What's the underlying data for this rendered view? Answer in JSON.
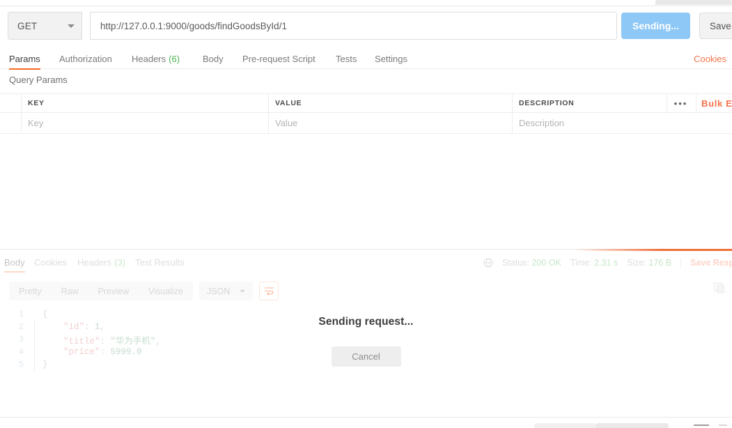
{
  "request": {
    "method": "GET",
    "url": "http://127.0.0.1:9000/goods/findGoodsById/1",
    "send_label": "Sending...",
    "save_label": "Save",
    "cookies_label": "Cookies",
    "tabs": [
      {
        "label": "Params",
        "count": "",
        "active": true
      },
      {
        "label": "Authorization",
        "count": "",
        "active": false
      },
      {
        "label": "Headers",
        "count": "(6)",
        "active": false
      },
      {
        "label": "Body",
        "count": "",
        "active": false
      },
      {
        "label": "Pre-request Script",
        "count": "",
        "active": false
      },
      {
        "label": "Tests",
        "count": "",
        "active": false
      },
      {
        "label": "Settings",
        "count": "",
        "active": false
      }
    ]
  },
  "query_params": {
    "section_title": "Query Params",
    "columns": [
      "KEY",
      "VALUE",
      "DESCRIPTION"
    ],
    "placeholders": {
      "key": "Key",
      "value": "Value",
      "description": "Description"
    },
    "dots_label": "•••",
    "bulk_label": "Bulk Edit"
  },
  "response": {
    "tabs": [
      {
        "label": "Body",
        "count": "",
        "active": true
      },
      {
        "label": "Cookies",
        "count": "",
        "active": false
      },
      {
        "label": "Headers",
        "count": "(3)",
        "active": false
      },
      {
        "label": "Test Results",
        "count": "",
        "active": false
      }
    ],
    "meta": {
      "status_label": "Status:",
      "status_value": "200 OK",
      "time_label": "Time:",
      "time_value": "2.31 s",
      "size_label": "Size:",
      "size_value": "176 B",
      "save_response_label": "Save Response"
    },
    "format_tabs": [
      "Pretty",
      "Raw",
      "Preview",
      "Visualize"
    ],
    "language": "JSON",
    "body_lines": [
      {
        "n": "1",
        "tokens": [
          {
            "t": "{",
            "c": "tk-punct"
          }
        ]
      },
      {
        "n": "2",
        "tokens": [
          {
            "t": "    \"id\"",
            "c": "tk-key"
          },
          {
            "t": ": ",
            "c": "tk-punct"
          },
          {
            "t": "1",
            "c": "tk-num"
          },
          {
            "t": ",",
            "c": "tk-punct"
          }
        ]
      },
      {
        "n": "3",
        "tokens": [
          {
            "t": "    \"title\"",
            "c": "tk-key"
          },
          {
            "t": ": ",
            "c": "tk-punct"
          },
          {
            "t": "\"华为手机\"",
            "c": "tk-str"
          },
          {
            "t": ",",
            "c": "tk-punct"
          }
        ]
      },
      {
        "n": "4",
        "tokens": [
          {
            "t": "    \"price\"",
            "c": "tk-key"
          },
          {
            "t": ": ",
            "c": "tk-punct"
          },
          {
            "t": "5999.0",
            "c": "tk-num"
          }
        ]
      },
      {
        "n": "5",
        "tokens": [
          {
            "t": "}",
            "c": "tk-punct"
          }
        ]
      }
    ]
  },
  "modal": {
    "title": "Sending request...",
    "cancel_label": "Cancel"
  },
  "colors": {
    "accent_orange": "#f26b21",
    "link_orange": "#f4714a",
    "send_blue": "#8ec8f6",
    "count_green": "#4caf50"
  }
}
